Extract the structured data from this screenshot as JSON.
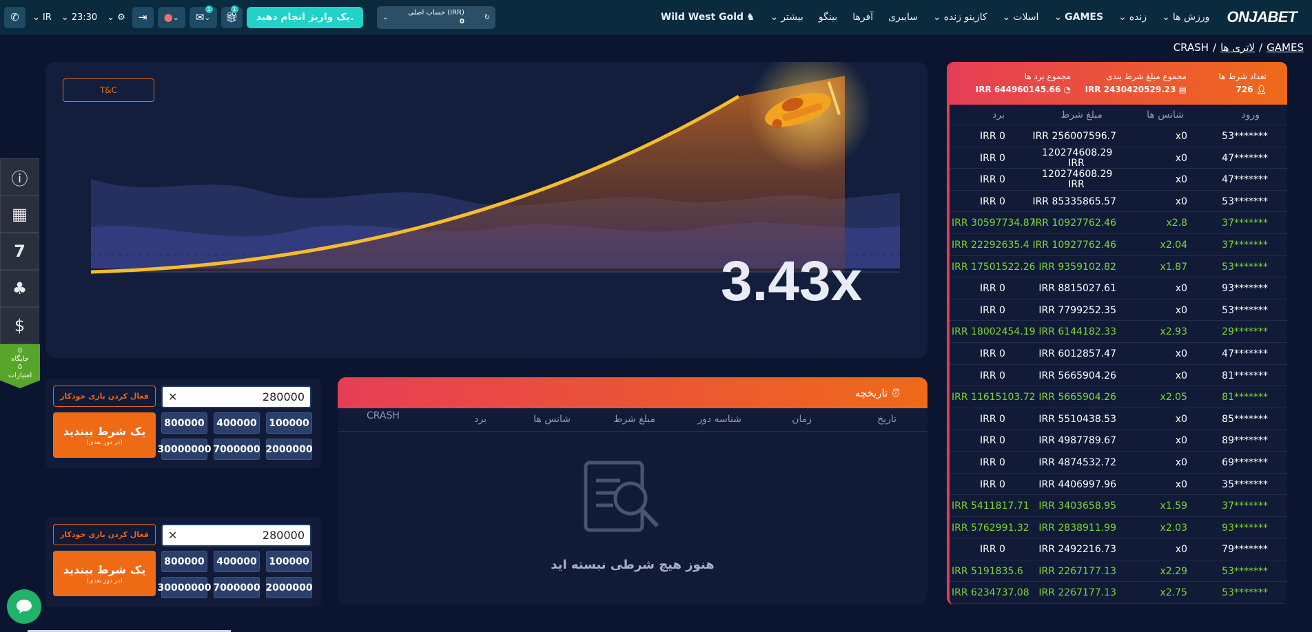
{
  "topbar": {
    "language": "IR",
    "time": "23:30",
    "deposit_label": "یک واریز انجام دهید.",
    "account_label": "حساب اصلی (IRR)",
    "account_balance": "0",
    "badge_messages": "1",
    "badge_gifts": "1"
  },
  "nav": {
    "items": [
      "ورزش ها",
      "زنده",
      "GAMES",
      "اسلات",
      "کازینو زنده",
      "سایبری",
      "آفرها",
      "بینگو",
      "بیشتر"
    ],
    "wild_west": "Wild West Gold",
    "logo": "ONJABET"
  },
  "breadcrumb": {
    "games": "GAMES",
    "lottery": "لاتری ها",
    "crash": "CRASH",
    "sep": "/"
  },
  "rail": {
    "score_top": "0",
    "score_label1": "جایگاه",
    "score_mid": "0",
    "score_label2": "امتیازات"
  },
  "game": {
    "tc": "T&C",
    "multiplier": "3.43x"
  },
  "bet_panels": [
    {
      "amount": "280000",
      "auto_label": "فعال کردن بازی خودکار",
      "place_label": "یک شرط ببندید",
      "place_sub": "(در دور بعدی)",
      "chips": [
        "800000",
        "400000",
        "100000",
        "30000000",
        "7000000",
        "2000000"
      ]
    },
    {
      "amount": "280000",
      "auto_label": "فعال کردن بازی خودکار",
      "place_label": "یک شرط ببندید",
      "place_sub": "(در دور بعدی)",
      "chips": [
        "800000",
        "400000",
        "100000",
        "30000000",
        "7000000",
        "2000000"
      ]
    }
  ],
  "history": {
    "title": "تاریخچه",
    "columns": [
      "تاریخ",
      "زمان",
      "شناسه دور",
      "مبلغ شرط",
      "شانس ها",
      "برد",
      "CRASH"
    ],
    "empty_message": "هنوز هیچ شرطی نبسته اید"
  },
  "stats": {
    "bets_count_label": "تعداد شرط ها",
    "bets_count": "726",
    "total_bet_label": "مجموع مبلغ شرط بندی",
    "total_bet": "IRR 2430420529.23",
    "total_win_label": "مجموع برد ها",
    "total_win": "IRR 644960145.66"
  },
  "bets_table": {
    "columns": [
      "ورود",
      "شانس ها",
      "مبلغ شرط",
      "برد"
    ],
    "rows": [
      {
        "user": "53*******",
        "odds": "x0",
        "bet": "IRR 256007596.7",
        "win": "IRR 0",
        "won": false
      },
      {
        "user": "47*******",
        "odds": "x0",
        "bet": "120274608.29 IRR",
        "win": "IRR 0",
        "won": false,
        "wrap": true
      },
      {
        "user": "47*******",
        "odds": "x0",
        "bet": "120274608.29 IRR",
        "win": "IRR 0",
        "won": false,
        "wrap": true
      },
      {
        "user": "53*******",
        "odds": "x0",
        "bet": "IRR 85335865.57",
        "win": "IRR 0",
        "won": false
      },
      {
        "user": "37*******",
        "odds": "x2.8",
        "bet": "IRR 10927762.46",
        "win": "IRR 30597734.87",
        "won": true
      },
      {
        "user": "37*******",
        "odds": "x2.04",
        "bet": "IRR 10927762.46",
        "win": "IRR 22292635.4",
        "won": true
      },
      {
        "user": "53*******",
        "odds": "x1.87",
        "bet": "IRR 9359102.82",
        "win": "IRR 17501522.26",
        "won": true
      },
      {
        "user": "93*******",
        "odds": "x0",
        "bet": "IRR 8815027.61",
        "win": "IRR 0",
        "won": false
      },
      {
        "user": "53*******",
        "odds": "x0",
        "bet": "IRR 7799252.35",
        "win": "IRR 0",
        "won": false
      },
      {
        "user": "29*******",
        "odds": "x2.93",
        "bet": "IRR 6144182.33",
        "win": "IRR 18002454.19",
        "won": true
      },
      {
        "user": "47*******",
        "odds": "x0",
        "bet": "IRR 6012857.47",
        "win": "IRR 0",
        "won": false
      },
      {
        "user": "81*******",
        "odds": "x0",
        "bet": "IRR 5665904.26",
        "win": "IRR 0",
        "won": false
      },
      {
        "user": "81*******",
        "odds": "x2.05",
        "bet": "IRR 5665904.26",
        "win": "IRR 11615103.72",
        "won": true
      },
      {
        "user": "85*******",
        "odds": "x0",
        "bet": "IRR 5510438.53",
        "win": "IRR 0",
        "won": false
      },
      {
        "user": "89*******",
        "odds": "x0",
        "bet": "IRR 4987789.67",
        "win": "IRR 0",
        "won": false
      },
      {
        "user": "69*******",
        "odds": "x0",
        "bet": "IRR 4874532.72",
        "win": "IRR 0",
        "won": false
      },
      {
        "user": "35*******",
        "odds": "x0",
        "bet": "IRR 4406997.96",
        "win": "IRR 0",
        "won": false
      },
      {
        "user": "37*******",
        "odds": "x1.59",
        "bet": "IRR 3403658.95",
        "win": "IRR 5411817.71",
        "won": true
      },
      {
        "user": "93*******",
        "odds": "x2.03",
        "bet": "IRR 2838911.99",
        "win": "IRR 5762991.32",
        "won": true
      },
      {
        "user": "79*******",
        "odds": "x0",
        "bet": "IRR 2492216.73",
        "win": "IRR 0",
        "won": false
      },
      {
        "user": "53*******",
        "odds": "x2.29",
        "bet": "IRR 2267177.13",
        "win": "IRR 5191835.6",
        "won": true
      },
      {
        "user": "53*******",
        "odds": "x2.75",
        "bet": "IRR 2267177.13",
        "win": "IRR 6234737.08",
        "won": true
      }
    ]
  }
}
